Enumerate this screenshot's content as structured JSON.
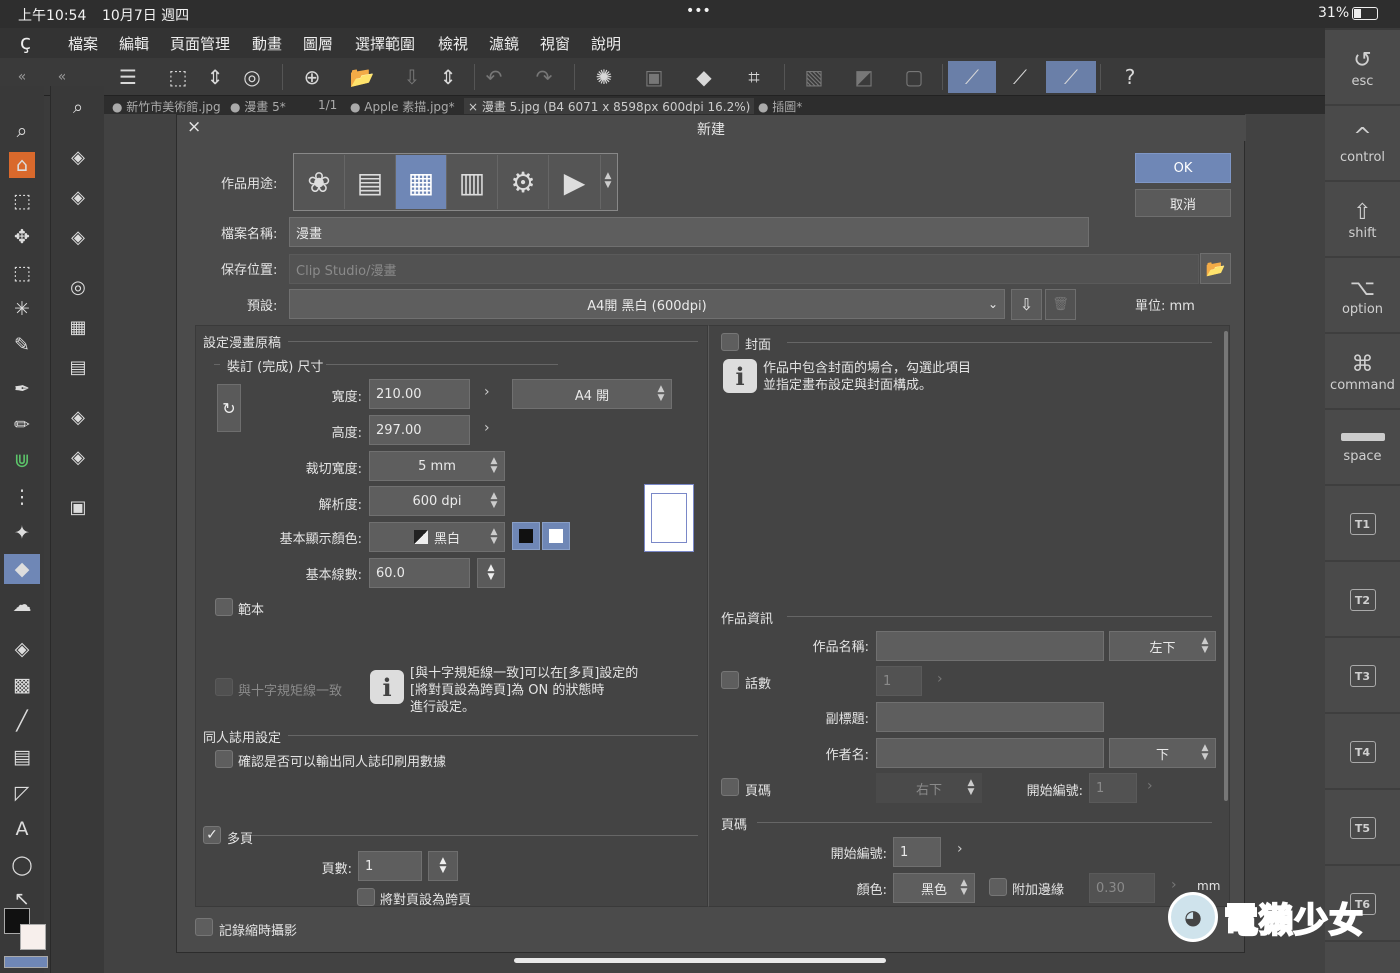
{
  "status": {
    "time": "上午10:54",
    "date": "10月7日 週四",
    "dots": "•••",
    "battery": "31%"
  },
  "menu": [
    "檔案",
    "編輯",
    "頁面管理",
    "動畫",
    "圖層",
    "選擇範圍",
    "檢視",
    "濾鏡",
    "視窗",
    "說明"
  ],
  "tabs": [
    "● 新竹市美術館.jpg",
    "● 漫畫 5*",
    "1/1",
    "● Apple 素描.jpg*",
    "× 漫畫 5.jpg (B4 6071 x 8598px 600dpi 16.2%)",
    "● 插圖*"
  ],
  "dialog": {
    "title": "新建",
    "ok": "OK",
    "cancel": "取消",
    "purpose_label": "作品用途:",
    "filename_label": "檔案名稱:",
    "filename_value": "漫畫",
    "savepath_label": "保存位置:",
    "savepath_value": "Clip Studio/漫畫",
    "preset_label": "預設:",
    "preset_value": "A4開 黑白 (600dpi)",
    "unit_label": "單位: mm",
    "left": {
      "section": "設定漫畫原稿",
      "sub": "裝訂 (完成) 尺寸",
      "width_label": "寬度:",
      "width_value": "210.00",
      "height_label": "高度:",
      "height_value": "297.00",
      "size_preset": "A4 開",
      "bleed_label": "裁切寬度:",
      "bleed_value": "5 mm",
      "res_label": "解析度:",
      "res_value": "600 dpi",
      "color_label": "基本顯示顏色:",
      "color_value": "黑白",
      "lines_label": "基本線數:",
      "lines_value": "60.0",
      "template": "範本",
      "cross_align": "與十字規矩線一致",
      "cross_info": [
        "[與十字規矩線一致]可以在[多頁]設定的",
        "[將對頁設為跨頁]為 ON 的狀態時",
        "進行設定。"
      ],
      "doujin_section": "同人誌用設定",
      "doujin_check": "確認是否可以輸出同人誌印刷用數據",
      "multipage": "多頁",
      "pages_label": "頁數:",
      "pages_value": "1",
      "spread": "將對頁設為跨頁"
    },
    "right": {
      "cover": "封面",
      "cover_info": [
        "作品中包含封面的場合，勾選此項目",
        "並指定畫布設定與封面構成。"
      ],
      "workinfo": "作品資訊",
      "title_label": "作品名稱:",
      "title_pos": "左下",
      "episode": "話數",
      "episode_value": "1",
      "subtitle_label": "副標題:",
      "author_label": "作者名:",
      "author_pos": "下",
      "pagenum": "頁碼",
      "pagenum_pos": "右下",
      "start_label": "開始編號:",
      "start_value": "1",
      "folio": "頁碼",
      "folio_start_label": "開始編號:",
      "folio_start_value": "1",
      "color_label": "顏色:",
      "color_value": "黑色",
      "margin": "附加邊緣",
      "margin_value": "0.30",
      "mm": "mm"
    },
    "timelapse": "記錄縮時攝影"
  },
  "keys": {
    "esc": "esc",
    "control": "control",
    "shift": "shift",
    "option": "option",
    "command": "command",
    "space": "space",
    "t": [
      "T1",
      "T2",
      "T3",
      "T4",
      "T5",
      "T6"
    ]
  },
  "watermark": "電獺少女"
}
